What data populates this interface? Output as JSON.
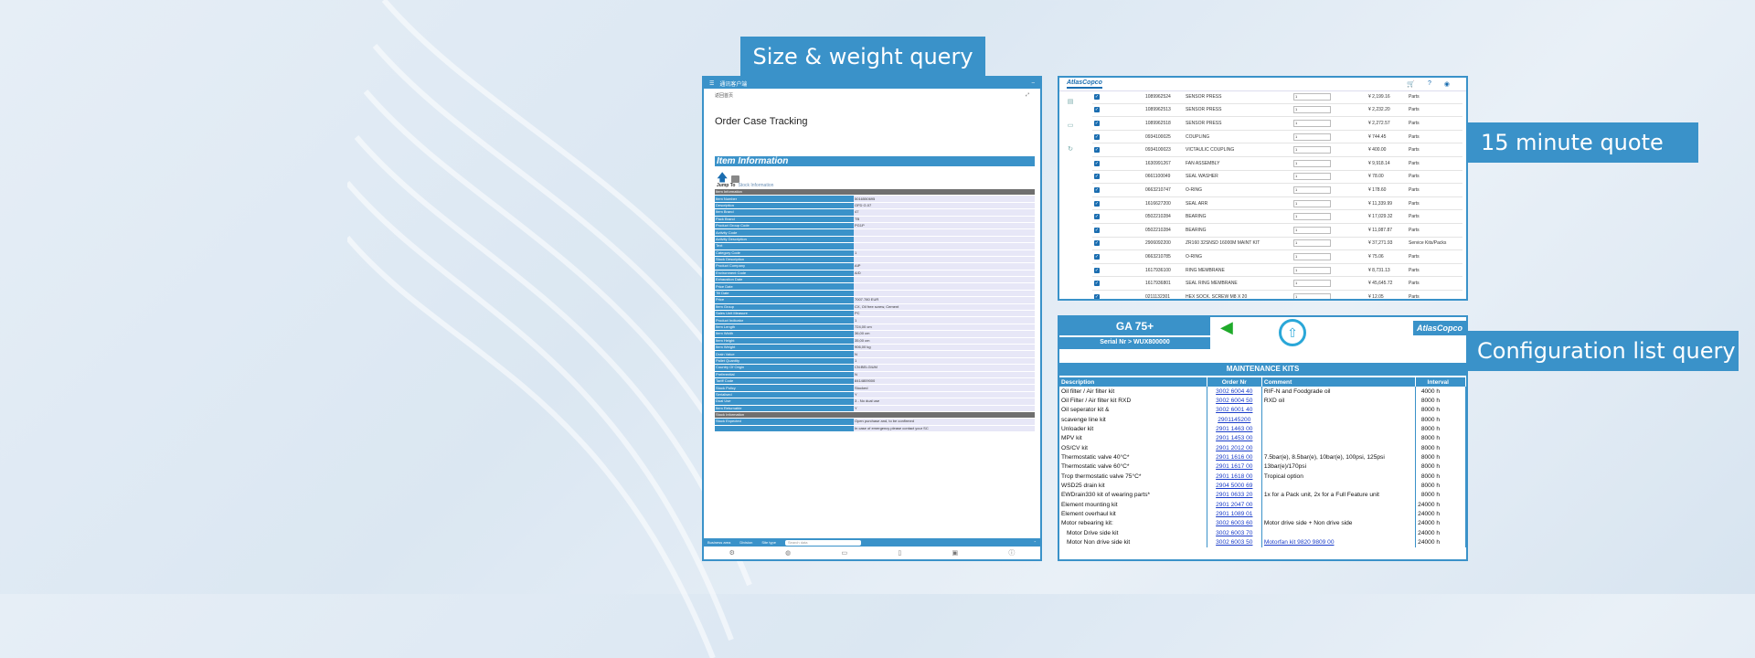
{
  "labels": {
    "size_weight": "Size & weight query",
    "quote": "15 minute quote",
    "config": "Configuration list query"
  },
  "order_panel": {
    "topbar_title": "通讯客户端",
    "sub_left": "返回首页",
    "title": "Order Case Tracking",
    "section": "Item Information",
    "jump_label": "Jump To",
    "jump_link": "Stock Information",
    "rows": [
      {
        "k": "Item Information",
        "v": "",
        "hdr": true
      },
      {
        "k": "Item Number",
        "v": "5016550695"
      },
      {
        "k": "Description",
        "v": "OFD G.07"
      },
      {
        "k": "Item Brand",
        "v": "47"
      },
      {
        "k": "Pack Brand",
        "v": "TB"
      },
      {
        "k": "Product Group Code",
        "v": "PG1P"
      },
      {
        "k": "Activity Code",
        "v": ""
      },
      {
        "k": "Activity Description",
        "v": ""
      },
      {
        "k": "Text",
        "v": ""
      },
      {
        "k": "Category Code",
        "v": "1"
      },
      {
        "k": "Stock Description",
        "v": ""
      },
      {
        "k": "Product Company",
        "v": "AIP"
      },
      {
        "k": "Environment Code",
        "v": "A/D"
      },
      {
        "k": "Exhaustion Date",
        "v": ""
      },
      {
        "k": "Price Date",
        "v": ""
      },
      {
        "k": "Till Date",
        "v": ""
      },
      {
        "k": "Price",
        "v": "7007.780 EUR"
      },
      {
        "k": "Item Group",
        "v": "CX, Oil free screw, Cement"
      },
      {
        "k": "Sales Unit Measure",
        "v": "PC"
      },
      {
        "k": "Product Indicator",
        "v": "1"
      },
      {
        "k": "Item Length",
        "v": "724,00 cm"
      },
      {
        "k": "Item Width",
        "v": "36,00 cm"
      },
      {
        "k": "Item Height",
        "v": "35,00 cm"
      },
      {
        "k": "Item Weight",
        "v": "906,00 kg"
      },
      {
        "k": "Drain Value",
        "v": "N"
      },
      {
        "k": "Pallet Quantity",
        "v": "1"
      },
      {
        "k": "Country Of Origin",
        "v": "CN:BELGIUM"
      },
      {
        "k": "Preferential",
        "v": "N"
      },
      {
        "k": "Tariff Code",
        "v": "8414809000"
      },
      {
        "k": "Stock Policy",
        "v": "Stocked"
      },
      {
        "k": "Serialised",
        "v": "Y"
      },
      {
        "k": "Dual Use",
        "v": "3 - No dual use"
      },
      {
        "k": "Item Returnable",
        "v": "Y"
      },
      {
        "k": "Stock Information",
        "v": "",
        "hdr": true
      },
      {
        "k": "Stock Expected",
        "v": "Open purchase and, to be confirmed"
      },
      {
        "k": "",
        "v": "In case of emergency please contact your SC"
      }
    ],
    "footer": {
      "business_area": "Business area",
      "division": "Division",
      "user_type": "Site type",
      "search_placeholder": "Search data"
    }
  },
  "quote_panel": {
    "logo": "AtlasCopco",
    "rows": [
      {
        "part": "1089962524",
        "desc": "SENSOR PRESS",
        "qty": "1",
        "price": "¥ 2,199.16",
        "type": "Parts"
      },
      {
        "part": "1089962513",
        "desc": "SENSOR PRESS",
        "qty": "1",
        "price": "¥ 2,232.20",
        "type": "Parts"
      },
      {
        "part": "1089962518",
        "desc": "SENSOR PRESS",
        "qty": "1",
        "price": "¥ 2,272.57",
        "type": "Parts"
      },
      {
        "part": "0934100025",
        "desc": "COUPLING",
        "qty": "1",
        "price": "¥ 744.45",
        "type": "Parts"
      },
      {
        "part": "0934100023",
        "desc": "VICTAULIC COUPLING",
        "qty": "1",
        "price": "¥ 400.00",
        "type": "Parts"
      },
      {
        "part": "1630991267",
        "desc": "FAN ASSEMBLY",
        "qty": "1",
        "price": "¥ 9,918.14",
        "type": "Parts"
      },
      {
        "part": "0661100049",
        "desc": "SEAL WASHER",
        "qty": "1",
        "price": "¥ 78.00",
        "type": "Parts"
      },
      {
        "part": "0663210747",
        "desc": "O-RING",
        "qty": "1",
        "price": "¥ 178.60",
        "type": "Parts"
      },
      {
        "part": "1616627200",
        "desc": "SEAL ARR",
        "qty": "1",
        "price": "¥ 11,339.99",
        "type": "Parts"
      },
      {
        "part": "0502210284",
        "desc": "BEARING",
        "qty": "1",
        "price": "¥ 17,029.32",
        "type": "Parts"
      },
      {
        "part": "0502210284",
        "desc": "BEARING",
        "qty": "1",
        "price": "¥ 11,087.87",
        "type": "Parts"
      },
      {
        "part": "2906092200",
        "desc": "ZR160 32SNSD 16000M MAINT KIT",
        "qty": "1",
        "price": "¥ 37,271.93",
        "type": "Service Kits/Packs"
      },
      {
        "part": "0663210785",
        "desc": "O-RING",
        "qty": "1",
        "price": "¥ 75.06",
        "type": "Parts"
      },
      {
        "part": "1617936100",
        "desc": "RING MEMBRANE",
        "qty": "1",
        "price": "¥ 8,731.13",
        "type": "Parts"
      },
      {
        "part": "1617936801",
        "desc": "SEAL RING MEMBRANE",
        "qty": "1",
        "price": "¥ 45,645.72",
        "type": "Parts"
      },
      {
        "part": "0211132301",
        "desc": "HEX SOCK. SCREW M8 X 20",
        "qty": "1",
        "price": "¥ 12.05",
        "type": "Parts"
      }
    ]
  },
  "config_panel": {
    "model": "GA 75+",
    "serial": "Serial Nr > WUX800000",
    "logo": "AtlasCopco",
    "band": "MAINTENANCE KITS",
    "headers": {
      "desc": "Description",
      "order": "Order Nr",
      "comment": "Comment",
      "interval": "Interval"
    },
    "rows": [
      {
        "desc": "Oil filter / Air filter kit",
        "order": "3002 6004 40",
        "comment": "RIF-N and Foodgrade oil",
        "interval": "4000 h"
      },
      {
        "desc": "Oil Filter / Air filter kit RXD",
        "order": "3002 6004 50",
        "comment": "RXD oil",
        "interval": "8000 h"
      },
      {
        "desc": "Oil seperator kit &",
        "order": "3002 6001 40",
        "comment": "",
        "interval": "8000 h"
      },
      {
        "desc": "scavenge line kit",
        "order": "2901145200",
        "comment": "",
        "interval": "8000 h"
      },
      {
        "desc": "Unloader kit",
        "order": "2901 1463 00",
        "comment": "",
        "interval": "8000 h"
      },
      {
        "desc": "MPV kit",
        "order": "2901 1453 00",
        "comment": "",
        "interval": "8000 h"
      },
      {
        "desc": "OS/CV kit",
        "order": "2901 2012 00",
        "comment": "",
        "interval": "8000 h"
      },
      {
        "desc": "Thermostatic valve 40°C*",
        "order": "2901 1616 00",
        "comment": "7.5bar(e), 8.5bar(e), 10bar(e), 100psi, 125psi",
        "interval": "8000 h"
      },
      {
        "desc": "Thermostatic valve 60°C*",
        "order": "2901 1617 00",
        "comment": "13bar(e)/170psi",
        "interval": "8000 h"
      },
      {
        "desc": "Trop thermostatic valve 75°C*",
        "order": "2901 1618 00",
        "comment": "Tropical option",
        "interval": "8000 h"
      },
      {
        "desc": "WSD25 drain kit",
        "order": "2904 5000 69",
        "comment": "",
        "interval": "8000 h"
      },
      {
        "desc": "EWDrain330 kit of wearing parts*",
        "order": "2901 0633 20",
        "comment": "1x for a Pack unit, 2x for a Full Feature unit",
        "interval": "8000 h"
      },
      {
        "desc": "Element mounting kit",
        "order": "2901 2047 00",
        "comment": "",
        "interval": "24000 h"
      },
      {
        "desc": "Element overhaul kit",
        "order": "2901 1089 01",
        "comment": "",
        "interval": "24000 h"
      },
      {
        "desc": "Motor rebearing kit:",
        "order": "3002 6003 60",
        "comment": "Motor drive side + Non drive side",
        "interval": "24000 h"
      },
      {
        "desc": "Motor Drive side kit",
        "order": "3002 6003 70",
        "comment": "",
        "interval": "24000 h",
        "indent": true
      },
      {
        "desc": "Motor Non drive side kit",
        "order": "3002 6003 50",
        "comment": "Motorfan kit 9820 9809 00",
        "interval": "24000 h",
        "indent": true,
        "link": true
      }
    ]
  }
}
